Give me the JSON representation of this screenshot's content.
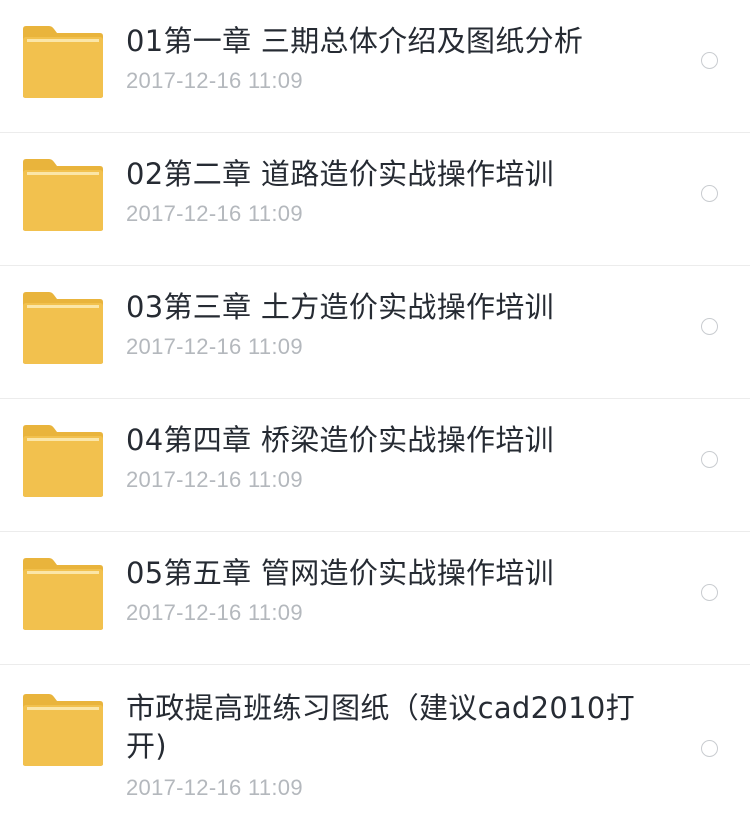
{
  "files": [
    {
      "name": "01第一章 三期总体介绍及图纸分析",
      "date": "2017-12-16  11:09",
      "icon": "folder-icon"
    },
    {
      "name": "02第二章 道路造价实战操作培训",
      "date": "2017-12-16  11:09",
      "icon": "folder-icon"
    },
    {
      "name": "03第三章 土方造价实战操作培训",
      "date": "2017-12-16  11:09",
      "icon": "folder-icon"
    },
    {
      "name": "04第四章 桥梁造价实战操作培训",
      "date": "2017-12-16  11:09",
      "icon": "folder-icon"
    },
    {
      "name": "05第五章 管网造价实战操作培训",
      "date": "2017-12-16  11:09",
      "icon": "folder-icon"
    },
    {
      "name": "市政提高班练习图纸（建议cad2010打开)",
      "date": "2017-12-16  11:09",
      "icon": "folder-icon"
    }
  ],
  "colors": {
    "folder_body": "#f2c14e",
    "folder_tab": "#e9b43c",
    "folder_stripe": "#fbe6a8",
    "name_text": "#262b33",
    "date_text": "#b4b8bd",
    "divider": "#ececec",
    "radio_border": "#c9ccd0"
  }
}
